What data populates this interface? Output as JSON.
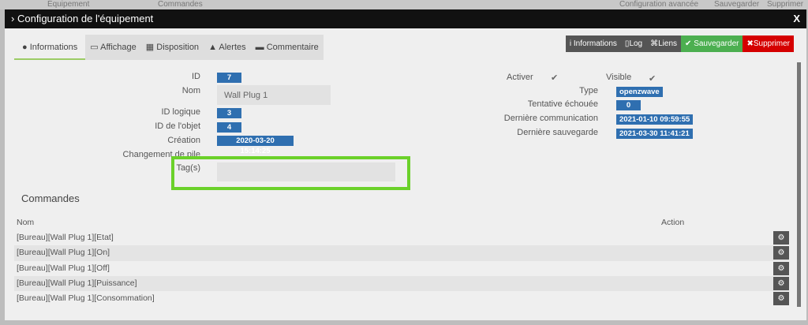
{
  "background": {
    "items": [
      "Équipement",
      "Commandes",
      "Configuration avancée",
      "Sauvegarder",
      "Supprimer"
    ]
  },
  "modal": {
    "title": "Configuration de l'équipement",
    "close": "X"
  },
  "tabs": [
    {
      "label": "Informations",
      "icon": "info-circle-icon"
    },
    {
      "label": "Affichage",
      "icon": "monitor-icon"
    },
    {
      "label": "Disposition",
      "icon": "grid-icon"
    },
    {
      "label": "Alertes",
      "icon": "warning-icon"
    },
    {
      "label": "Commentaire",
      "icon": "comment-icon"
    }
  ],
  "actions": {
    "informations": "Informations",
    "log": "Log",
    "liens": "Liens",
    "save": "Sauvegarder",
    "delete": "Supprimer"
  },
  "left": {
    "id_label": "ID",
    "id": "7",
    "nom_label": "Nom",
    "nom": "Wall Plug 1",
    "logical_label": "ID logique",
    "logical": "3",
    "object_label": "ID de l'objet",
    "object": "4",
    "creation_label": "Création",
    "creation": "2020-03-20 15:14:25",
    "battery_label": "Changement de pile",
    "tags_label": "Tag(s)",
    "tags": ""
  },
  "right": {
    "activer_label": "Activer",
    "visible_label": "Visible",
    "type_label": "Type",
    "type": "openzwave",
    "failed_label": "Tentative échouée",
    "failed": "0",
    "lastcomm_label": "Dernière communication",
    "lastcomm": "2021-01-10 09:59:55",
    "lastsave_label": "Dernière sauvegarde",
    "lastsave": "2021-03-30 11:41:21"
  },
  "commands": {
    "title": "Commandes",
    "col_nom": "Nom",
    "col_action": "Action",
    "rows": [
      "[Bureau][Wall Plug 1][Etat]",
      "[Bureau][Wall Plug 1][On]",
      "[Bureau][Wall Plug 1][Off]",
      "[Bureau][Wall Plug 1][Puissance]",
      "[Bureau][Wall Plug 1][Consommation]"
    ]
  },
  "colors": {
    "badge": "#2f6fb0",
    "save": "#4caf50",
    "delete": "#d50000",
    "highlight": "#6bd12a"
  }
}
